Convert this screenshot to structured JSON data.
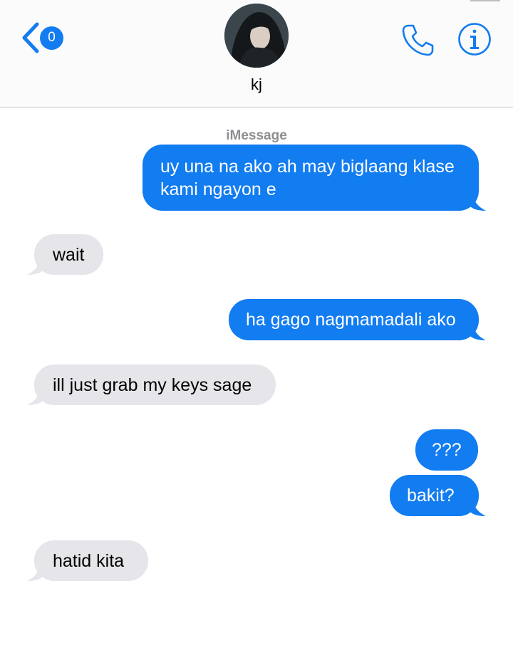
{
  "header": {
    "unread_count": "0",
    "contact_name": "kj"
  },
  "conversation": {
    "service_label": "iMessage",
    "messages": [
      {
        "direction": "sent",
        "text": "uy una na ako ah may biglaang klase kami ngayon e"
      },
      {
        "direction": "received",
        "text": "wait"
      },
      {
        "direction": "sent",
        "text": "ha gago nagmamadali ako"
      },
      {
        "direction": "received",
        "text": "ill just grab my keys sage"
      },
      {
        "direction": "sent",
        "text": "???"
      },
      {
        "direction": "sent",
        "text": "bakit?"
      },
      {
        "direction": "received",
        "text": "hatid kita"
      }
    ]
  },
  "colors": {
    "accent": "#127cf1",
    "sent_bubble": "#127cf1",
    "received_bubble": "#e5e5ea",
    "service_label": "#8e8e93"
  },
  "icons": [
    "back-chevron-icon",
    "phone-icon",
    "info-icon"
  ]
}
